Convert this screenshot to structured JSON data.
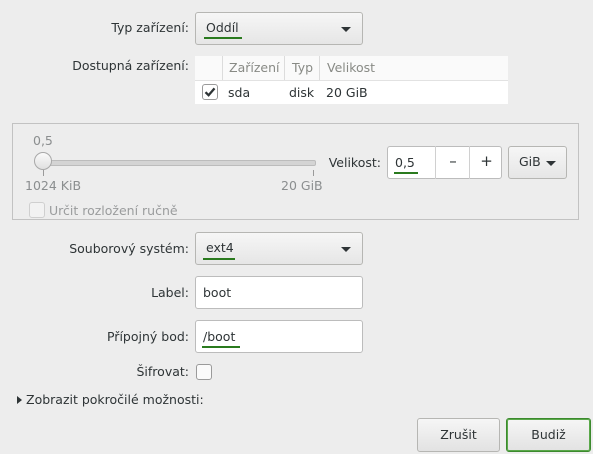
{
  "device_type": {
    "label": "Typ zařízení:",
    "value": "Oddíl"
  },
  "available_devices": {
    "label": "Dostupná zařízení:",
    "columns": [
      "Zařízení",
      "Typ",
      "Velikost"
    ],
    "rows": [
      {
        "checked": true,
        "device": "sda",
        "type": "disk",
        "size": "20 GiB"
      }
    ]
  },
  "size_section": {
    "slider_value": "0,5",
    "slider_min": "1024 KiB",
    "slider_max": "20 GiB",
    "slider_fraction": 0.0,
    "manual_layout_label": "Určit rozložení ručně",
    "size_label": "Velikost:",
    "size_value": "0,5",
    "minus": "–",
    "plus": "+",
    "unit": "GiB"
  },
  "filesystem": {
    "label": "Souborový systém:",
    "value": "ext4"
  },
  "label_field": {
    "label": "Label:",
    "value": "boot"
  },
  "mount_point": {
    "label": "Přípojný bod:",
    "value": "/boot"
  },
  "encrypt": {
    "label": "Šifrovat:",
    "checked": false
  },
  "advanced": {
    "label": "Zobrazit pokročilé možnosti:"
  },
  "buttons": {
    "cancel": "Zrušit",
    "create": "Budiž"
  },
  "colors": {
    "accent": "#2a7a1e",
    "default_button_border": "#3c8a2e"
  }
}
